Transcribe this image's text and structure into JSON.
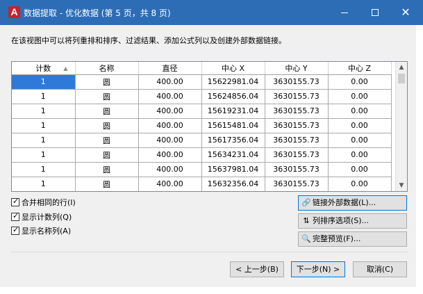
{
  "window": {
    "icon_letter": "A",
    "title": "数据提取 - 优化数据 (第 5 页，共 8 页)",
    "minimize_icon": "minimize-icon",
    "maximize_icon": "maximize-icon",
    "close_glyph": "✕"
  },
  "instruction": "在该视图中可以将列重排和排序、过滤结果、添加公式列以及创建外部数据链接。",
  "grid": {
    "columns": [
      "计数",
      "名称",
      "直径",
      "中心 X",
      "中心 Y",
      "中心 Z"
    ],
    "sort_indicator": "▲",
    "rows": [
      [
        "1",
        "圆",
        "400.00",
        "15622981.04",
        "3630155.73",
        "0.00"
      ],
      [
        "1",
        "圆",
        "400.00",
        "15624856.04",
        "3630155.73",
        "0.00"
      ],
      [
        "1",
        "圆",
        "400.00",
        "15619231.04",
        "3630155.73",
        "0.00"
      ],
      [
        "1",
        "圆",
        "400.00",
        "15615481.04",
        "3630155.73",
        "0.00"
      ],
      [
        "1",
        "圆",
        "400.00",
        "15617356.04",
        "3630155.73",
        "0.00"
      ],
      [
        "1",
        "圆",
        "400.00",
        "15634231.04",
        "3630155.73",
        "0.00"
      ],
      [
        "1",
        "圆",
        "400.00",
        "15637981.04",
        "3630155.73",
        "0.00"
      ],
      [
        "1",
        "圆",
        "400.00",
        "15632356.04",
        "3630155.73",
        "0.00"
      ]
    ],
    "scroll_up_glyph": "▲",
    "scroll_down_glyph": "▼"
  },
  "options": [
    {
      "label": "合并相同的行(I)",
      "checked": true
    },
    {
      "label": "显示计数列(Q)",
      "checked": true
    },
    {
      "label": "显示名称列(A)",
      "checked": true
    }
  ],
  "side_buttons": [
    {
      "label": "链接外部数据(L)...",
      "icon": "link-icon",
      "glyph": "🔗"
    },
    {
      "label": "列排序选项(S)...",
      "icon": "sort-icon",
      "glyph": "⇅"
    },
    {
      "label": "完整预览(F)...",
      "icon": "preview-icon",
      "glyph": "🔍"
    }
  ],
  "footer": {
    "back": "< 上一步(B)",
    "next": "下一步(N) >",
    "cancel": "取消(C)"
  }
}
